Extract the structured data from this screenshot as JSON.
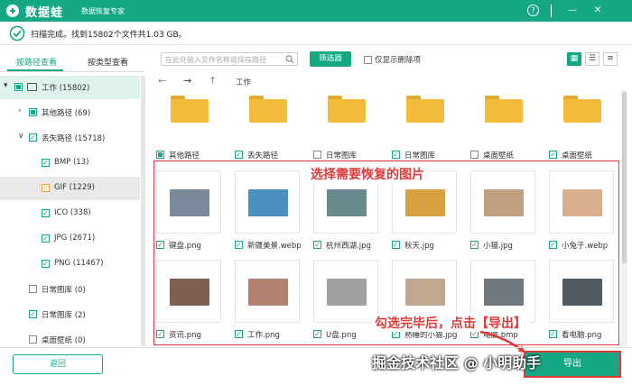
{
  "app": {
    "brand": "数据蛙",
    "subtitle": "数据恢复专家"
  },
  "titlebar": {
    "help": "?",
    "minimize": "—",
    "close": "✕"
  },
  "status": {
    "text": "扫描完成。找到15802个文件共1.03 GB。"
  },
  "sidebar": {
    "tabs": [
      {
        "label": "按路径查看",
        "active": true
      },
      {
        "label": "按类型查看",
        "active": false
      }
    ],
    "tree": [
      {
        "label": "工作 (15802)",
        "level": 0,
        "check": "partial",
        "arrow": "▾",
        "icon": "drive-icon",
        "selected": true
      },
      {
        "label": "其他路径 (69)",
        "level": 1,
        "check": "partial",
        "arrow": "›"
      },
      {
        "label": "丢失路径 (15718)",
        "level": 1,
        "check": "checked",
        "arrow": "∨"
      },
      {
        "label": "BMP (13)",
        "level": 2,
        "check": "checked"
      },
      {
        "label": "GIF (1229)",
        "level": 2,
        "check": "orange",
        "highlight": true
      },
      {
        "label": "ICO (338)",
        "level": 2,
        "check": "checked"
      },
      {
        "label": "JPG (2671)",
        "level": 2,
        "check": "checked"
      },
      {
        "label": "PNG (11467)",
        "level": 2,
        "check": "checked"
      },
      {
        "label": "日常图库 (0)",
        "level": 1,
        "check": "unchecked"
      },
      {
        "label": "日常图库 (2)",
        "level": 1,
        "check": "checked"
      },
      {
        "label": "桌面壁纸 (0)",
        "level": 1,
        "check": "unchecked"
      }
    ]
  },
  "toolbar": {
    "search_placeholder": "在此处输入文件名称或保存路径",
    "search_icon": "search-icon",
    "filter_label": "筛选器",
    "only_deleted_label": "仅显示删除项",
    "views": [
      "grid-view-icon",
      "list-view-icon",
      "detail-view-icon"
    ]
  },
  "nav": {
    "back": "←",
    "forward": "→",
    "up": "↑",
    "crumb": "工作"
  },
  "folders": [
    {
      "label": "其他路径",
      "check": "partial"
    },
    {
      "label": "丢失路径",
      "check": "checked"
    },
    {
      "label": "日常图库",
      "check": "unchecked"
    },
    {
      "label": "日常图库",
      "check": "checked"
    },
    {
      "label": "桌面壁纸",
      "check": "unchecked"
    },
    {
      "label": "桌面壁纸",
      "check": "checked"
    }
  ],
  "images_row1": [
    {
      "label": "键盘.png",
      "color": "#7a8a9a"
    },
    {
      "label": "新疆美景.webp",
      "color": "#4a90c0"
    },
    {
      "label": "杭州西湖.jpg",
      "color": "#6a8a90"
    },
    {
      "label": "秋天.jpg",
      "color": "#d8a040"
    },
    {
      "label": "小猫.jpg",
      "color": "#c0a080"
    },
    {
      "label": "小兔子.webp",
      "color": "#d8b090"
    }
  ],
  "images_row2": [
    {
      "label": "资讯.png",
      "color": "#806050"
    },
    {
      "label": "工作.png",
      "color": "#b08070"
    },
    {
      "label": "U盘.png",
      "color": "#a0a0a0"
    },
    {
      "label": "熟睡的小猫.jpg",
      "color": "#c0a890"
    },
    {
      "label": "电脑.bmp",
      "color": "#707880"
    },
    {
      "label": "看电脑.png",
      "color": "#505860"
    }
  ],
  "annotations": {
    "select_images": "选择需要恢复的图片",
    "after_check": "勾选完毕后，点击【导出】",
    "watermark": "掘金技术社区 @ 小明助手"
  },
  "bottom": {
    "back_label": "返回",
    "export_label": "导出"
  },
  "colors": {
    "accent": "#16a785",
    "annotation": "#e23a3a",
    "folder": "#f2bb3a"
  }
}
